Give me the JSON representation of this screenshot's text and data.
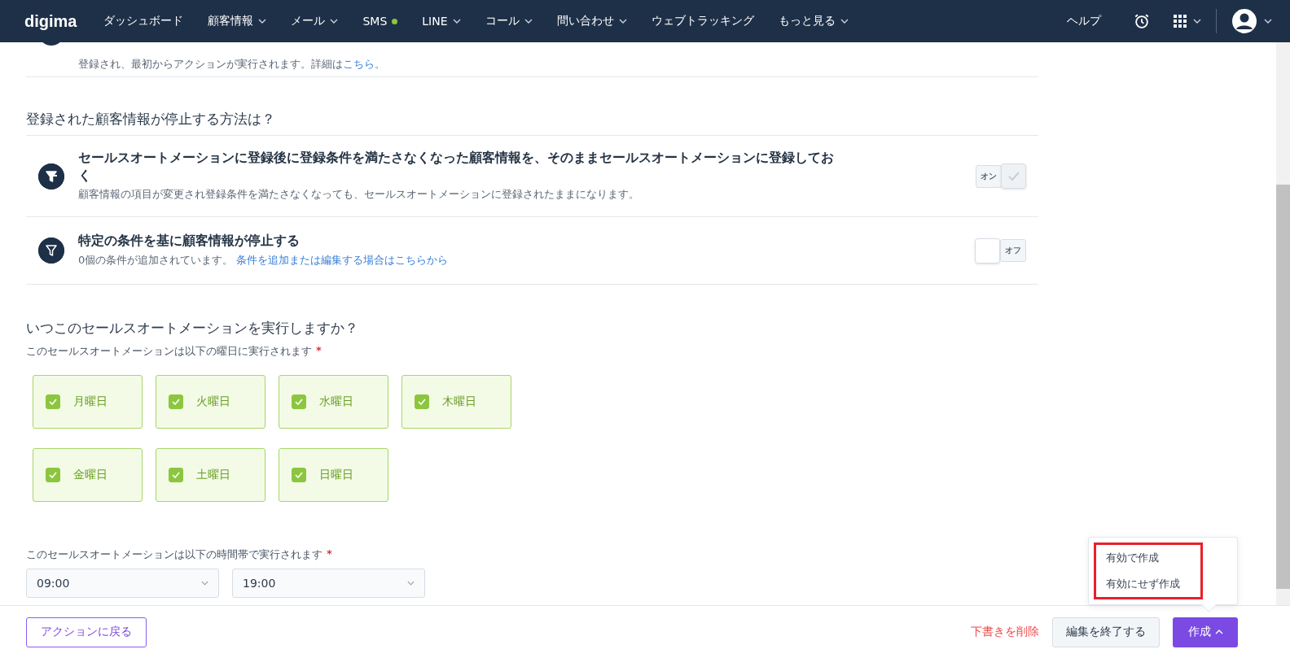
{
  "nav": {
    "logo": "digima",
    "items": [
      {
        "label": "ダッシュボード",
        "dropdown": false,
        "dot": false
      },
      {
        "label": "顧客情報",
        "dropdown": true,
        "dot": false
      },
      {
        "label": "メール",
        "dropdown": true,
        "dot": false
      },
      {
        "label": "SMS",
        "dropdown": false,
        "dot": true
      },
      {
        "label": "LINE",
        "dropdown": true,
        "dot": false
      },
      {
        "label": "コール",
        "dropdown": true,
        "dot": false
      },
      {
        "label": "問い合わせ",
        "dropdown": true,
        "dot": false
      },
      {
        "label": "ウェブトラッキング",
        "dropdown": false,
        "dot": false
      },
      {
        "label": "もっと見る",
        "dropdown": true,
        "dot": false
      }
    ],
    "help": "ヘルプ"
  },
  "previous_row": {
    "description": "登録され、最初からアクションが実行されます。詳細は",
    "link": "こちら",
    "tail": "。"
  },
  "stop_section": {
    "title": "登録された顧客情報が停止する方法は？",
    "options": [
      {
        "kind": "keep",
        "title": "セールスオートメーションに登録後に登録条件を満たさなくなった顧客情報を、そのままセールスオートメーションに登録しておく",
        "description": "顧客情報の項目が変更され登録条件を満たさなくなっても、セールスオートメーションに登録されたままになります。",
        "on": true,
        "toggle_label": "オン"
      },
      {
        "kind": "condition",
        "title": "特定の条件を基に顧客情報が停止する",
        "description": "0個の条件が追加されています。",
        "link": "条件を追加または編集する場合はこちらから",
        "on": false,
        "toggle_label": "オフ"
      }
    ]
  },
  "schedule": {
    "title": "いつこのセールスオートメーションを実行しますか？",
    "days_label": "このセールスオートメーションは以下の曜日に実行されます",
    "required_mark": "*",
    "days": [
      {
        "label": "月曜日",
        "checked": true
      },
      {
        "label": "火曜日",
        "checked": true
      },
      {
        "label": "水曜日",
        "checked": true
      },
      {
        "label": "木曜日",
        "checked": true
      },
      {
        "label": "金曜日",
        "checked": true
      },
      {
        "label": "土曜日",
        "checked": true
      },
      {
        "label": "日曜日",
        "checked": true
      }
    ],
    "time_label": "このセールスオートメーションは以下の時間帯で実行されます",
    "time_required_mark": "*",
    "times": [
      "09:00",
      "19:00"
    ]
  },
  "footer": {
    "back_button": "アクションに戻る",
    "delete_link": "下書きを削除",
    "finish_button": "編集を終了する",
    "create_button": "作成",
    "create_menu": {
      "expanded": true,
      "highlighted": true,
      "items": [
        "有効で作成",
        "有効にせず作成"
      ]
    }
  }
}
